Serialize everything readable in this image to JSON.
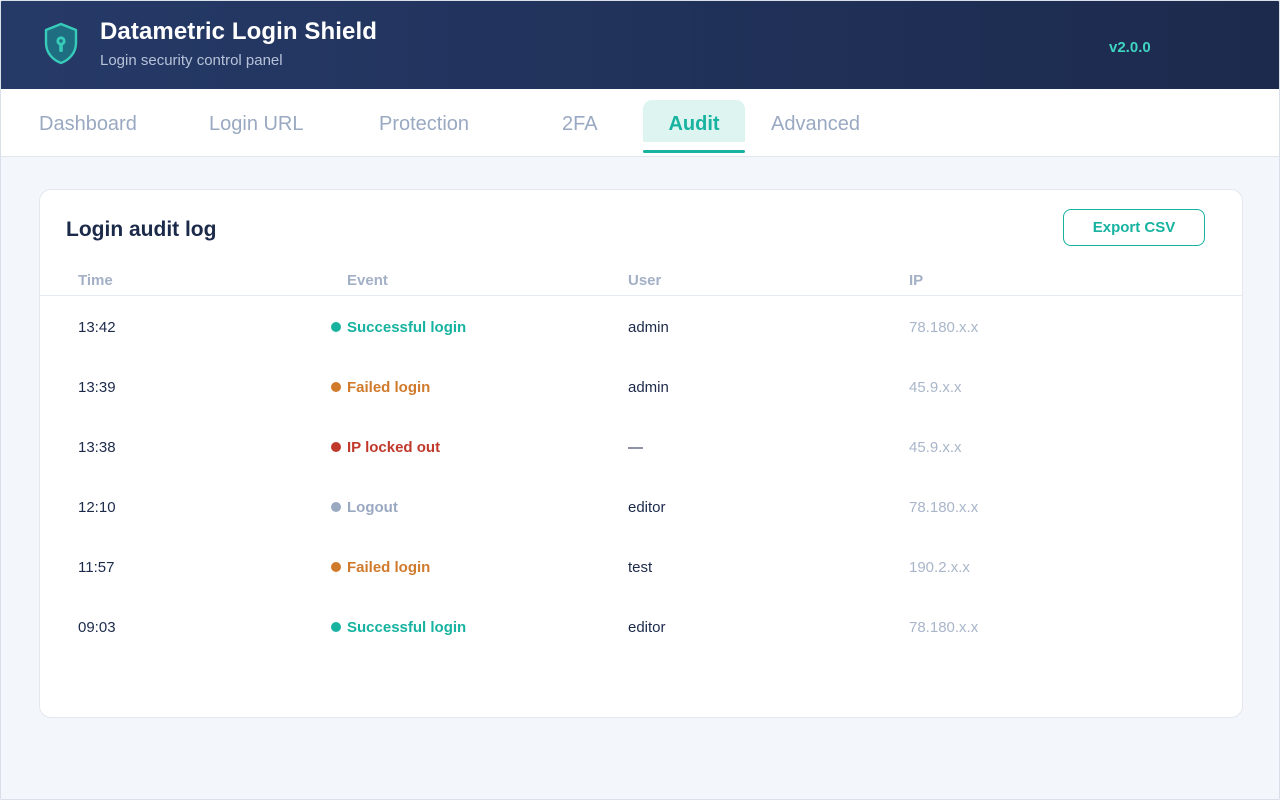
{
  "app": {
    "title": "Datametric Login Shield",
    "subtitle": "Login security control panel",
    "version": "v2.0.0"
  },
  "tabs": [
    {
      "label": "Dashboard",
      "active": false
    },
    {
      "label": "Login URL",
      "active": false
    },
    {
      "label": "Protection",
      "active": false
    },
    {
      "label": "2FA",
      "active": false
    },
    {
      "label": "Audit",
      "active": true
    },
    {
      "label": "Advanced",
      "active": false
    }
  ],
  "audit": {
    "title": "Login audit log",
    "export_label": "Export CSV",
    "columns": {
      "time": "Time",
      "event": "Event",
      "user": "User",
      "ip": "IP"
    },
    "rows": [
      {
        "time": "13:42",
        "event": "Successful login",
        "status": "success",
        "user": "admin",
        "ip": "78.180.x.x"
      },
      {
        "time": "13:39",
        "event": "Failed login",
        "status": "failed",
        "user": "admin",
        "ip": "45.9.x.x"
      },
      {
        "time": "13:38",
        "event": "IP locked out",
        "status": "locked",
        "user": "—",
        "ip": "45.9.x.x"
      },
      {
        "time": "12:10",
        "event": "Logout",
        "status": "logout",
        "user": "editor",
        "ip": "78.180.x.x"
      },
      {
        "time": "11:57",
        "event": "Failed login",
        "status": "failed",
        "user": "test",
        "ip": "190.2.x.x"
      },
      {
        "time": "09:03",
        "event": "Successful login",
        "status": "success",
        "user": "editor",
        "ip": "78.180.x.x"
      }
    ]
  },
  "colors": {
    "accent": "#17b3a0",
    "success": "#17b3a0",
    "failed": "#d07a2c",
    "locked": "#c0392b",
    "logout": "#9aa9c2",
    "header_bg": "#1f2f55"
  },
  "icons": {
    "logo": "shield-keyhole-icon"
  }
}
